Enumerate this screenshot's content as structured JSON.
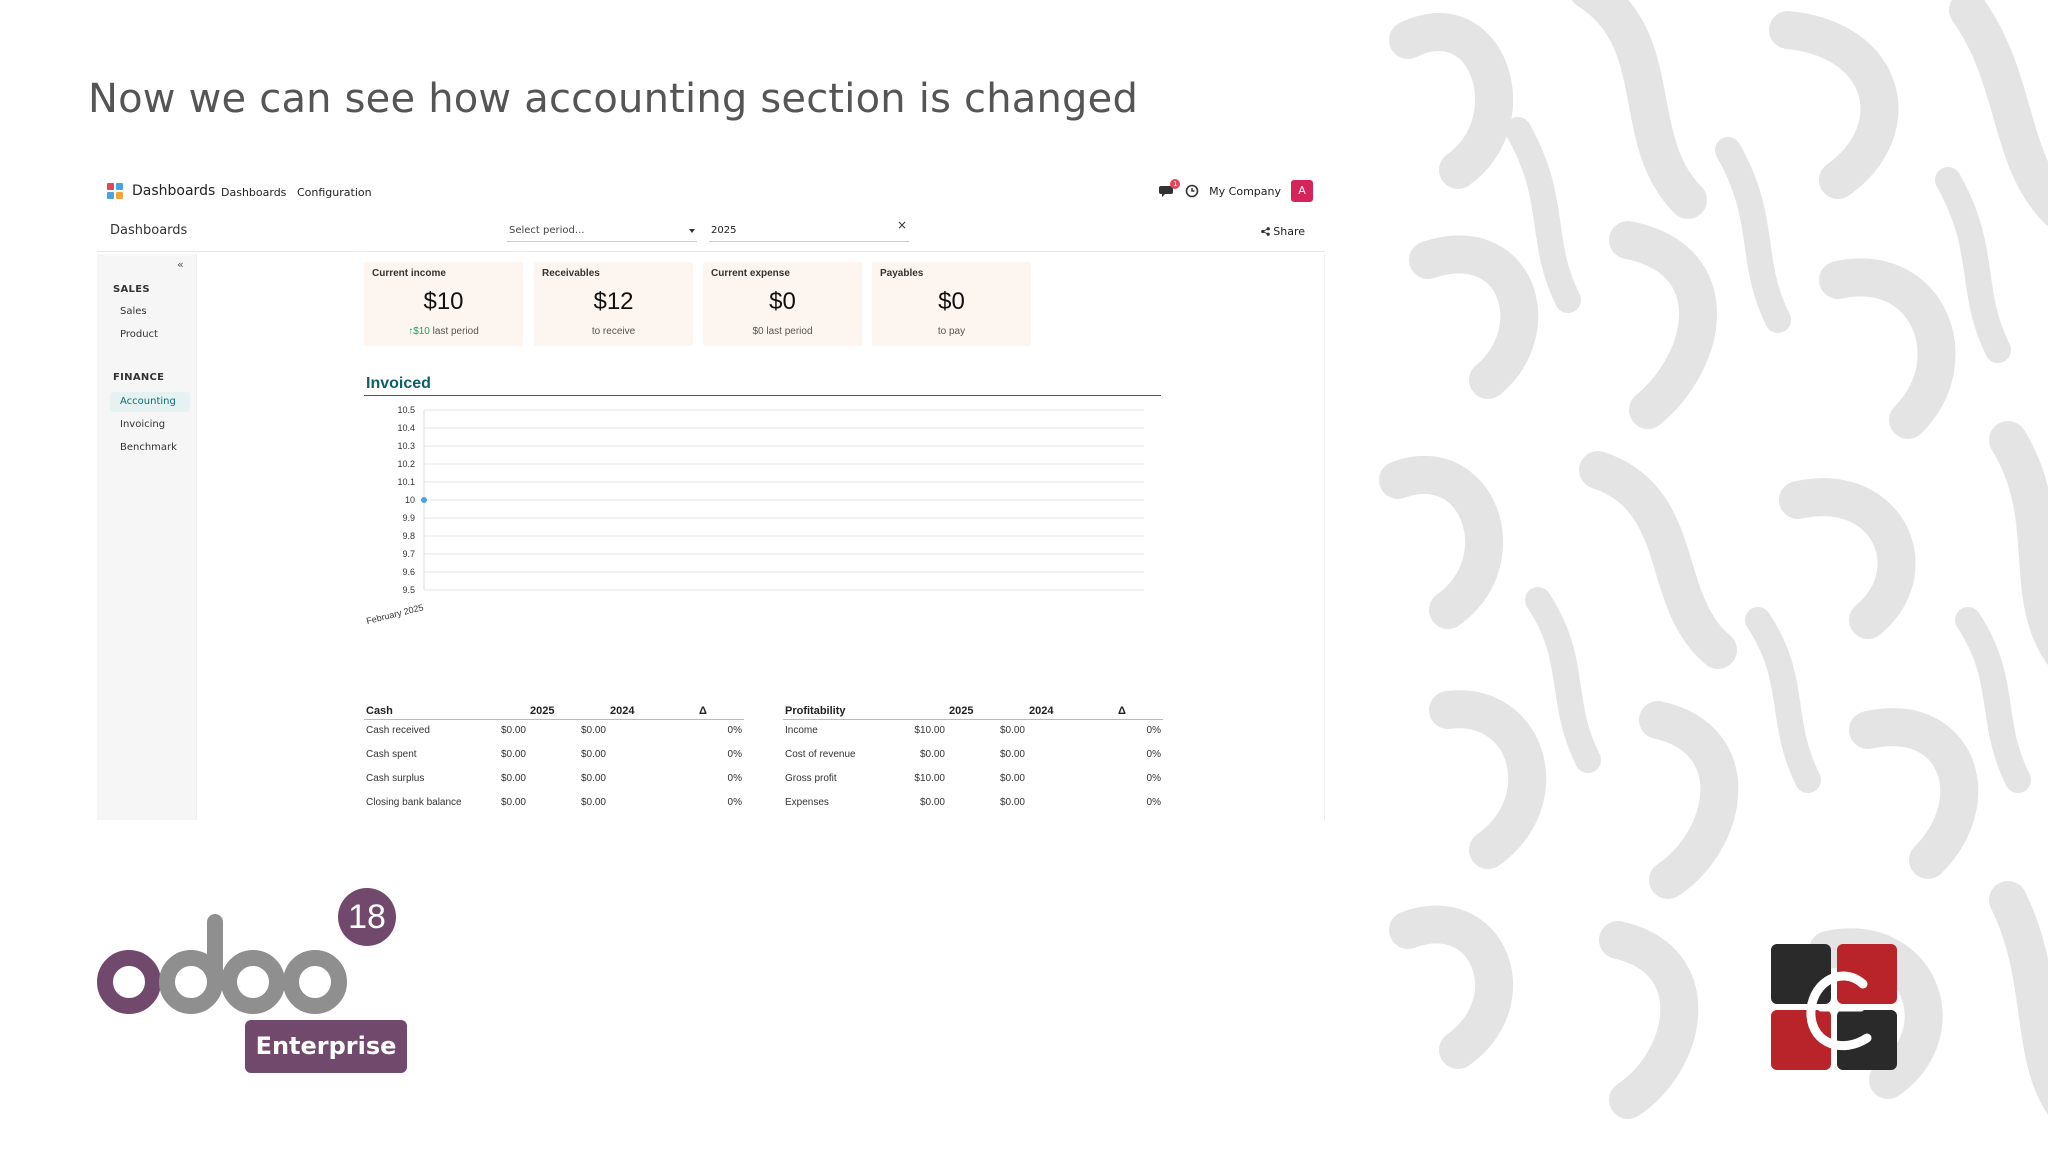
{
  "slide": {
    "title": "Now we can see how accounting section is changed"
  },
  "app": {
    "name": "Dashboards",
    "menu": [
      "Dashboards",
      "Configuration"
    ],
    "company": "My Company",
    "avatar_letter": "A",
    "chat_badge": "1"
  },
  "controls": {
    "breadcrumb": "Dashboards",
    "period_placeholder": "Select period...",
    "year": "2025",
    "clear": "×",
    "share": "Share"
  },
  "sidebar": {
    "collapse": "«",
    "sections": [
      {
        "title": "SALES",
        "items": [
          "Sales",
          "Product"
        ]
      },
      {
        "title": "FINANCE",
        "items": [
          "Accounting",
          "Invoicing",
          "Benchmark"
        ]
      }
    ],
    "active_item": "Accounting"
  },
  "kpis": [
    {
      "label": "Current income",
      "value": "$10",
      "trend": "$10",
      "sub": "last period"
    },
    {
      "label": "Receivables",
      "value": "$12",
      "sub": "to receive"
    },
    {
      "label": "Current expense",
      "value": "$0",
      "sub": "$0 last period"
    },
    {
      "label": "Payables",
      "value": "$0",
      "sub": "to pay"
    }
  ],
  "chart_data": {
    "type": "line",
    "title": "Invoiced",
    "x": [
      "February 2025"
    ],
    "series": [
      {
        "values": [
          10
        ]
      }
    ],
    "ylim": [
      9.5,
      10.5
    ],
    "yticks": [
      "10.5",
      "10.4",
      "10.3",
      "10.2",
      "10.1",
      "10",
      "9.9",
      "9.8",
      "9.7",
      "9.6",
      "9.5"
    ],
    "grid": true,
    "color": "#4aa3df"
  },
  "tables": {
    "cash": {
      "headers": [
        "Cash",
        "2025",
        "2024",
        "Δ"
      ],
      "rows": [
        [
          "Cash received",
          "$0.00",
          "$0.00",
          "0%"
        ],
        [
          "Cash spent",
          "$0.00",
          "$0.00",
          "0%"
        ],
        [
          "Cash surplus",
          "$0.00",
          "$0.00",
          "0%"
        ],
        [
          "Closing bank balance",
          "$0.00",
          "$0.00",
          "0%"
        ]
      ]
    },
    "profitability": {
      "headers": [
        "Profitability",
        "2025",
        "2024",
        "Δ"
      ],
      "rows": [
        [
          "Income",
          "$10.00",
          "$0.00",
          "0%"
        ],
        [
          "Cost of revenue",
          "$0.00",
          "$0.00",
          "0%"
        ],
        [
          "Gross profit",
          "$10.00",
          "$0.00",
          "0%"
        ],
        [
          "Expenses",
          "$0.00",
          "$0.00",
          "0%"
        ]
      ]
    }
  },
  "branding": {
    "product": "odoo",
    "version": "18",
    "edition": "Enterprise",
    "colors": {
      "purple": "#71496d",
      "grey": "#8f8f8f",
      "red": "#b9242a",
      "dark": "#2a2a2a"
    }
  }
}
